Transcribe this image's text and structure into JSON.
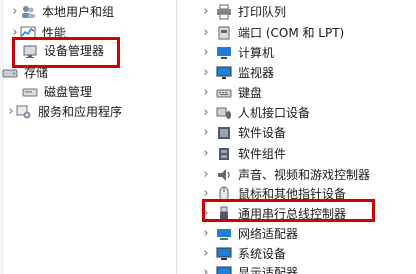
{
  "colors": {
    "highlight": "#d40000",
    "chevron": "#6e6e6e",
    "text": "#1a1a1a"
  },
  "left_tree": {
    "items": [
      {
        "label": "本地用户和组",
        "icon": "users-icon"
      },
      {
        "label": "性能",
        "icon": "performance-icon"
      },
      {
        "label": "设备管理器",
        "icon": "device-manager-icon"
      },
      {
        "label": "存储",
        "icon": "storage-icon"
      },
      {
        "label": "磁盘管理",
        "icon": "disk-management-icon"
      },
      {
        "label": "服务和应用程序",
        "icon": "services-icon"
      }
    ]
  },
  "right_tree": {
    "items": [
      {
        "label": "打印队列",
        "icon": "printer-icon"
      },
      {
        "label": "端口 (COM 和 LPT)",
        "icon": "port-icon"
      },
      {
        "label": "计算机",
        "icon": "computer-icon"
      },
      {
        "label": "监视器",
        "icon": "monitor-icon"
      },
      {
        "label": "键盘",
        "icon": "keyboard-icon"
      },
      {
        "label": "人机接口设备",
        "icon": "hid-icon"
      },
      {
        "label": "软件设备",
        "icon": "software-device-icon"
      },
      {
        "label": "软件组件",
        "icon": "software-component-icon"
      },
      {
        "label": "声音、视频和游戏控制器",
        "icon": "sound-icon"
      },
      {
        "label": "鼠标和其他指针设备",
        "icon": "mouse-icon"
      },
      {
        "label": "通用串行总线控制器",
        "icon": "usb-icon"
      },
      {
        "label": "网络适配器",
        "icon": "network-adapter-icon"
      },
      {
        "label": "系统设备",
        "icon": "system-device-icon"
      },
      {
        "label": "显示适配器",
        "icon": "display-adapter-icon"
      }
    ]
  }
}
